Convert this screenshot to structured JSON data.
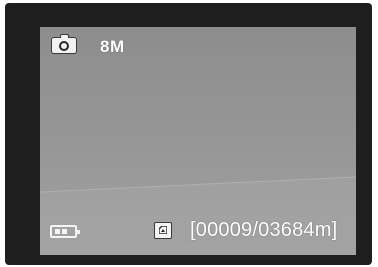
{
  "display": {
    "resolution": "8M",
    "counter": "[00009/03684m]",
    "capture_mode_icon": "camera-icon",
    "battery_icon": "battery-icon",
    "storage_icon": "memory-card-icon"
  },
  "colors": {
    "bezel": "#1e1e1e",
    "screen": "#999999",
    "overlay_text": "#ffffff"
  }
}
